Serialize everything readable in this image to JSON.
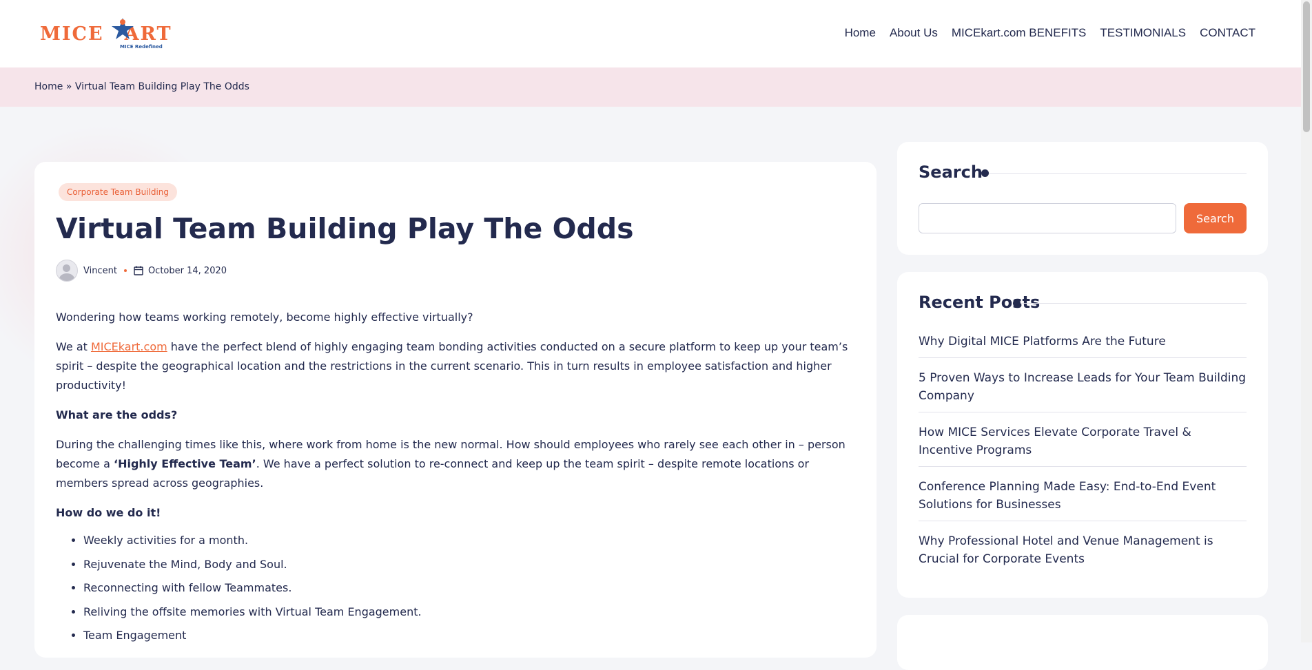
{
  "logo": {
    "text_left": "MICE",
    "text_right": "ART",
    "tagline": "MICE Redefined"
  },
  "nav": [
    "Home",
    "About Us",
    "MICEkart.com BENEFITS",
    "TESTIMONIALS",
    "CONTACT"
  ],
  "breadcrumb": {
    "home": "Home",
    "separator": "»",
    "current": "Virtual Team Building Play The Odds"
  },
  "article": {
    "category": "Corporate Team Building",
    "title": "Virtual Team Building Play The Odds",
    "author": "Vincent",
    "date": "October 14, 2020",
    "p1": "Wondering how teams working remotely, become highly effective virtually?",
    "p2_before": "We at ",
    "p2_link": "MICEkart.com",
    "p2_after": " have the perfect blend of highly engaging team bonding activities conducted on a secure platform to keep up your team’s spirit – despite the geographical location and the restrictions in the current scenario. This in turn results in employee satisfaction and higher productivity!",
    "h1": "What are the odds?",
    "p3_before": "During the challenging times like this, where work from home is the new normal. How should employees who rarely see each other in – person become a ",
    "p3_bold": "‘Highly Effective Team’",
    "p3_after": ". We have a perfect solution to re-connect and keep up the team spirit – despite remote locations or members spread across geographies.",
    "h2": "How do we do it!",
    "bullets": [
      "Weekly activities for a month.",
      "Rejuvenate the Mind, Body and Soul.",
      "Reconnecting with fellow Teammates.",
      "Reliving the offsite memories with Virtual Team Engagement.",
      "Team Engagement"
    ]
  },
  "sidebar": {
    "search": {
      "title": "Search",
      "button": "Search",
      "value": ""
    },
    "recent": {
      "title": "Recent Posts",
      "posts": [
        "Why Digital MICE Platforms Are the Future",
        "5 Proven Ways to Increase Leads for Your Team Building Company",
        "How MICE Services Elevate Corporate Travel & Incentive Programs",
        "Conference Planning Made Easy: End-to-End Event Solutions for Businesses",
        "Why Professional Hotel and Venue Management is Crucial for Corporate Events"
      ]
    }
  },
  "colors": {
    "accent": "#ef6a3a",
    "navy": "#232a4e",
    "breadcrumb_bg": "#f6e4ea",
    "page_bg": "#f4f5f8"
  },
  "icons": {
    "date": "calendar-icon",
    "author": "avatar-icon",
    "logo": "star-figure-icon"
  }
}
